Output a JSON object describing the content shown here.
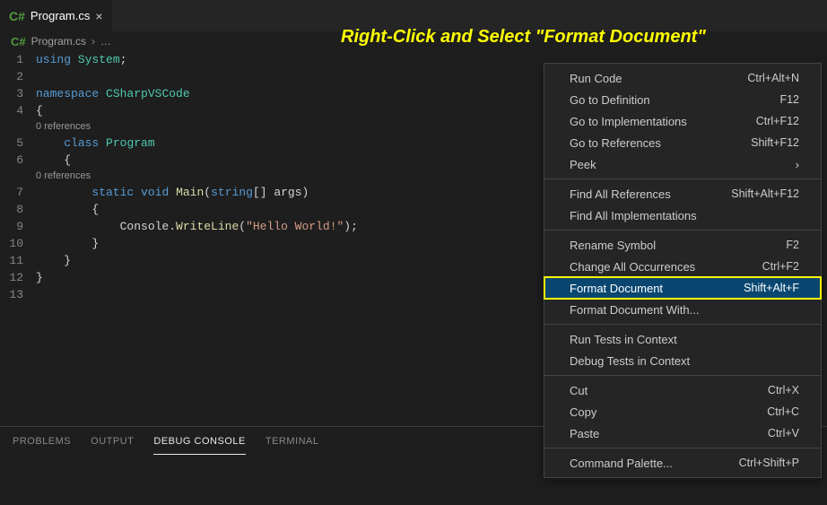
{
  "tab": {
    "filename": "Program.cs",
    "close_glyph": "×"
  },
  "breadcrumb": {
    "file": "Program.cs",
    "sep": "›",
    "ellipsis": "…"
  },
  "annotation": "Right-Click and Select \"Format Document\"",
  "gutter": [
    "1",
    "2",
    "3",
    "4",
    "5",
    "6",
    "7",
    "8",
    "9",
    "10",
    "11",
    "12",
    "13"
  ],
  "code": {
    "l1_using": "using",
    "l1_system": "System",
    "l1_semi": ";",
    "l3_ns": "namespace",
    "l3_name": "CSharpVSCode",
    "l4_brace": "{",
    "l_ref": "0 references",
    "l5_class": "class",
    "l5_name": "Program",
    "l6_brace": "    {",
    "l7_static": "static",
    "l7_void": "void",
    "l7_main": "Main",
    "l7_open": "(",
    "l7_string": "string",
    "l7_arr": "[] ",
    "l7_args": "args",
    "l7_close": ")",
    "l8_brace": "        {",
    "l9_console": "Console",
    "l9_dot": ".",
    "l9_wl": "WriteLine",
    "l9_open": "(",
    "l9_str": "\"Hello World!\"",
    "l9_close": ");",
    "l10_brace": "        }",
    "l11_brace": "    }",
    "l12_brace": "}"
  },
  "panel": {
    "problems": "PROBLEMS",
    "output": "OUTPUT",
    "debug_console": "DEBUG CONSOLE",
    "terminal": "TERMINAL"
  },
  "menu": {
    "groups": [
      [
        {
          "label": "Run Code",
          "shortcut": "Ctrl+Alt+N"
        },
        {
          "label": "Go to Definition",
          "shortcut": "F12"
        },
        {
          "label": "Go to Implementations",
          "shortcut": "Ctrl+F12"
        },
        {
          "label": "Go to References",
          "shortcut": "Shift+F12"
        },
        {
          "label": "Peek",
          "submenu": true
        }
      ],
      [
        {
          "label": "Find All References",
          "shortcut": "Shift+Alt+F12"
        },
        {
          "label": "Find All Implementations"
        }
      ],
      [
        {
          "label": "Rename Symbol",
          "shortcut": "F2"
        },
        {
          "label": "Change All Occurrences",
          "shortcut": "Ctrl+F2"
        },
        {
          "label": "Format Document",
          "shortcut": "Shift+Alt+F",
          "hovered": true,
          "highlighted": true
        },
        {
          "label": "Format Document With..."
        }
      ],
      [
        {
          "label": "Run Tests in Context"
        },
        {
          "label": "Debug Tests in Context"
        }
      ],
      [
        {
          "label": "Cut",
          "shortcut": "Ctrl+X"
        },
        {
          "label": "Copy",
          "shortcut": "Ctrl+C"
        },
        {
          "label": "Paste",
          "shortcut": "Ctrl+V"
        }
      ],
      [
        {
          "label": "Command Palette...",
          "shortcut": "Ctrl+Shift+P"
        }
      ]
    ]
  }
}
